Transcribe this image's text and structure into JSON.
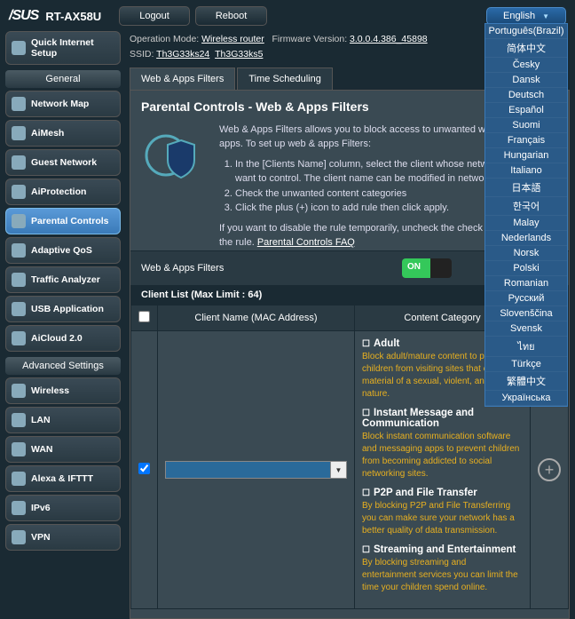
{
  "brand": "/SUS",
  "model": "RT-AX58U",
  "header": {
    "logout": "Logout",
    "reboot": "Reboot",
    "lang": "English"
  },
  "languages": [
    "Português(Brazil)",
    "简体中文",
    "Česky",
    "Dansk",
    "Deutsch",
    "Español",
    "Suomi",
    "Français",
    "Hungarian",
    "Italiano",
    "日本語",
    "한국어",
    "Malay",
    "Nederlands",
    "Norsk",
    "Polski",
    "Romanian",
    "Русский",
    "Slovenščina",
    "Svensk",
    "ไทย",
    "Türkçe",
    "繁體中文",
    "Українська"
  ],
  "info": {
    "opmode_label": "Operation Mode: ",
    "opmode": "Wireless router",
    "fw_label": "Firmware Version: ",
    "fw": "3.0.0.4.386_45898",
    "ssid_label": "SSID: ",
    "ssid1": "Th3G33ks24",
    "ssid2": "Th3G33ks5"
  },
  "sidebar": {
    "quick": "Quick Internet Setup",
    "general": "General",
    "items": [
      "Network Map",
      "AiMesh",
      "Guest Network",
      "AiProtection",
      "Parental Controls",
      "Adaptive QoS",
      "Traffic Analyzer",
      "USB Application",
      "AiCloud 2.0"
    ],
    "adv": "Advanced Settings",
    "adv_items": [
      "Wireless",
      "LAN",
      "WAN",
      "Alexa & IFTTT",
      "IPv6",
      "VPN"
    ]
  },
  "tabs": {
    "t1": "Web & Apps Filters",
    "t2": "Time Scheduling"
  },
  "page": {
    "title": "Parental Controls - Web & Apps Filters",
    "intro": "Web & Apps Filters allows you to block access to unwanted websites and apps. To set up web & apps Filters:",
    "step1": "In the [Clients Name] column, select the client whose network usage you want to control. The client name can be modified in network map client list.",
    "step2": "Check the unwanted content categories",
    "step3": "Click the plus (+) icon to add rule then click apply.",
    "note": "If you want to disable the rule temporarily, uncheck the check box in front of the rule.",
    "faq": "Parental Controls FAQ",
    "toggle_label": "Web & Apps Filters",
    "toggle_on": "ON",
    "list_hdr": "Client List (Max Limit : 64)",
    "col1": "Client Name (MAC Address)",
    "col2": "Content Category",
    "categories": [
      {
        "name": "Adult",
        "desc": "Block adult/mature content to prevent children from visiting sites that contain material of a sexual, violent, and illegal nature."
      },
      {
        "name": "Instant Message and Communication",
        "desc": "Block instant communication software and messaging apps to prevent children from becoming addicted to social networking sites."
      },
      {
        "name": "P2P and File Transfer",
        "desc": "By blocking P2P and File Transferring you can make sure your network has a better quality of data transmission."
      },
      {
        "name": "Streaming and Entertainment",
        "desc": "By blocking streaming and entertainment services you can limit the time your children spend online."
      }
    ]
  }
}
